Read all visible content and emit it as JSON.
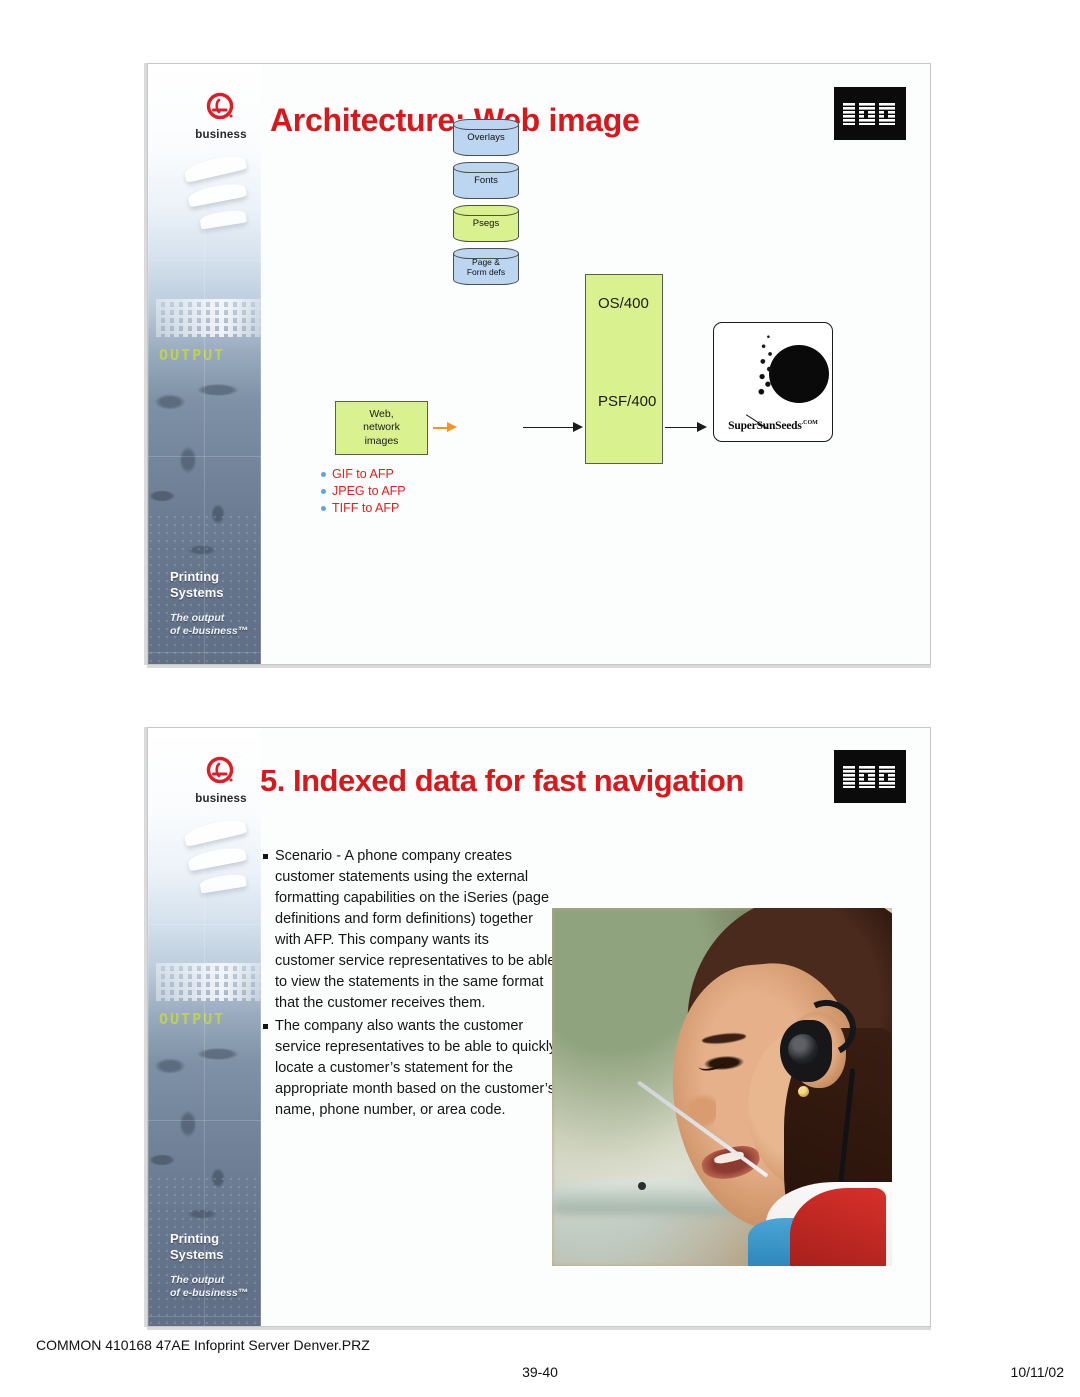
{
  "document": {
    "footer": {
      "file_label": "COMMON 410168 47AE Infoprint Server Denver.PRZ",
      "page_range": "39-40",
      "date": "10/11/02"
    }
  },
  "brand": {
    "ebusiness_word": "business",
    "ibm_logo_alt": "IBM",
    "sidebar": {
      "output_word": "OUTPUT",
      "printing_systems": "Printing\nSystems",
      "tagline": "The output\nof e-business™"
    },
    "colors": {
      "title_red": "#d8181b",
      "box_green": "#d9f18e",
      "cylinder_blue": "#bcd6f2",
      "bullet_blue": "#5aa7dd",
      "list_red": "#e0201d",
      "arrow_orange": "#f5941e"
    }
  },
  "slide1": {
    "number": 39,
    "title": "Architecture:  Web image",
    "diagram": {
      "source_box": "Web,\nnetwork\nimages",
      "cylinders": [
        {
          "label": "Overlays",
          "color": "blue"
        },
        {
          "label": "Fonts",
          "color": "blue"
        },
        {
          "label": "Psegs",
          "color": "green"
        },
        {
          "label": "Page &\nForm defs",
          "color": "blue"
        }
      ],
      "system_box": {
        "top_label": "OS/400",
        "bottom_label": "PSF/400"
      },
      "output_panel": {
        "logo_text": "SuperSunSeeds",
        "logo_suffix": ".COM"
      },
      "conversions": [
        "GIF to AFP",
        "JPEG to AFP",
        "TIFF to AFP"
      ]
    }
  },
  "slide2": {
    "number": 40,
    "title": "5. Indexed data for fast navigation",
    "bullets": [
      "Scenario - A phone company creates customer statements using the external formatting capabilities on the iSeries (page definitions and form definitions) together with AFP. This company wants its",
      "The company also wants the customer service representatives to be able to quickly locate a customer’s statement for the appropriate month based on the customer’s name, phone number, or area code."
    ],
    "bullet1_continuation": "customer service representatives to be able to view the statements in the same format that the customer receives them.",
    "photo_caption": "Customer service representative wearing a telephone headset"
  }
}
